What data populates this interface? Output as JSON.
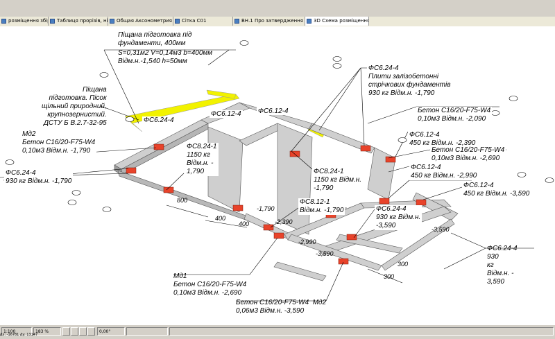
{
  "tabs": [
    {
      "label": "розміщення збірних за..."
    },
    {
      "label": "Таблиця прорізів, ніш і борозн."
    },
    {
      "label": "Общая Аксонометрия"
    },
    {
      "label": "Сітка С01"
    },
    {
      "label": "ВН.1 Про затвердження Пор..."
    },
    {
      "label": "3D Схема розміщення збірни..."
    }
  ],
  "annotations": {
    "sand_title": "Піщана підготовка під\nфундаменти, 400мм",
    "sand_dims": "S=0,31м2 V=0,14м3 b=400мм\nВідм.н.-1,540 h=50мм",
    "sand_desc": "Піщана\nпідготовка. Пісок\nщільний природний,\nкрупнозернистий.\nДСТУ Б В.2.7-32-95",
    "md2_top": "Мд2\nБетон С16/20-F75-W4\n0,10м3 Відм.н. -1,790",
    "fs624_left": "ФС6.24-4\n930 кг Відм.н. -1,790",
    "fs624_a": "ФС6.24-4",
    "fs612_a": "ФС6.12-4",
    "fs612_b": "ФС6.12-4",
    "fs824_1": "ФС8.24-1\n1150 кг\nВідм.н. -\n1,790",
    "fs624_top_right": "ФС6.24-4\nПлити залізобетонні\nстрічкових фундаментів\n930 кг Відм.н. -1,790",
    "concrete_2090": "Бетон С16/20-F75-W4\n0,10м3 Відм.н. -2,090",
    "fs612_2390": "ФС6.12-4\n450 кг Відм.н. -2,390",
    "concrete_2690": "Бетон С16/20-F75-W4\n0,10м3 Відм.н. -2,690",
    "fs612_2990": "ФС6.12-4\n450 кг Відм.н. -2,990",
    "fs612_3590": "ФС6.12-4\n450 кг Відм.н. -3,590",
    "fs824_1_mid": "ФС8.24-1\n1150 кг Відм.н.\n-1,790",
    "fs812_1": "ФС8.12-1\nВідм.н. -1,790",
    "fs624_3590": "ФС6.24-4\n930 кг Відм.н.\n-3,590",
    "fs624_right": "ФС6.24-4\n930\nкг\nВідм.н. -\n3,590",
    "md1": "Мд1\nБетон С16/20-F75-W4\n0,10м3 Відм.н. -2,690",
    "md2_bottom": "Бетон С16/20-F75-W4  Мд2\n0,06м3 Відм.н. -3,590"
  },
  "dimensions": {
    "d800": "800",
    "d400a": "400",
    "d400b": "400",
    "d300a": "300",
    "d300b": "300",
    "e1790": "-1,790",
    "e2390": "-2,390",
    "e2990": "-2,990",
    "e3590a": "-3,590",
    "e3590b": "-3,590"
  },
  "status": {
    "scale": "1:100",
    "zoom": "183 %",
    "angle": "0,00°",
    "coords": "Δx: -16781   Δy: 13147"
  },
  "colors": {
    "sand_yellow": "#f2f200",
    "block_red": "#e8432a",
    "concrete_gray": "#c9c9c9",
    "accent_blue": "#4a7fbf"
  }
}
